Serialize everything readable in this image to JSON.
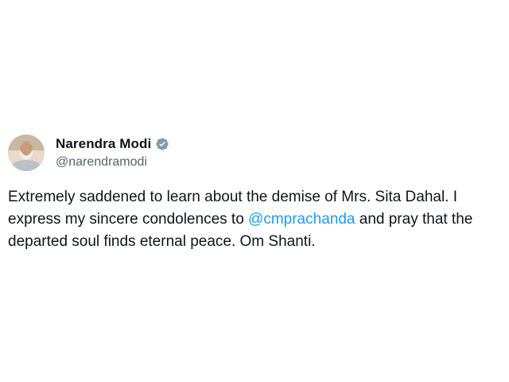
{
  "tweet": {
    "author": {
      "display_name": "Narendra Modi",
      "handle": "@narendramodi",
      "verified_icon": "verified-badge-icon",
      "avatar_icon": "avatar-photo"
    },
    "text": {
      "part1": "Extremely saddened to learn about the demise of Mrs. Sita Dahal. I express my sincere condolences to ",
      "mention": "@cmprachanda",
      "part2": " and pray that the departed soul finds eternal peace. Om Shanti."
    }
  },
  "colors": {
    "text_primary": "#0f1419",
    "text_secondary": "#536471",
    "link": "#1d9bf0",
    "verified_badge": "#829aab",
    "background": "#ffffff"
  }
}
